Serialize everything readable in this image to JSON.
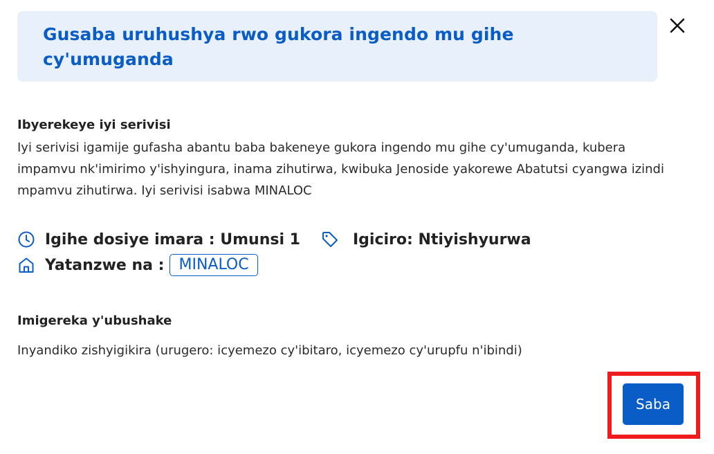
{
  "modal": {
    "title": "Gusaba uruhushya rwo gukora ingendo mu gihe cy'umuganda",
    "close_icon": "close-icon"
  },
  "about": {
    "heading": "Ibyerekeye iyi serivisi",
    "text": "Iyi serivisi igamije gufasha abantu baba bakeneye gukora ingendo mu gihe cy'umuganda, kubera impamvu nk'imirimo y'ishyingura, inama zihutirwa, kwibuka Jenoside yakorewe Abatutsi cyangwa izindi mpamvu zihutirwa. Iyi serivisi isabwa MINALOC"
  },
  "meta": {
    "processing_time": "Igihe dosiye imara : Umunsi 1",
    "price": "Igiciro: Ntiyishyurwa",
    "provided_by_label": "Yatanzwe na :",
    "provided_by_agency": "MINALOC"
  },
  "requirements": {
    "heading": "Imigereka y'ubushake",
    "text": "Inyandiko zishyigikira (urugero: icyemezo cy'ibitaro, icyemezo cy'urupfu n'ibindi)"
  },
  "actions": {
    "submit_label": "Saba"
  },
  "colors": {
    "accent": "#0a5cc6",
    "header_bg": "#e8f0fb",
    "highlight": "#ee1c1c"
  }
}
